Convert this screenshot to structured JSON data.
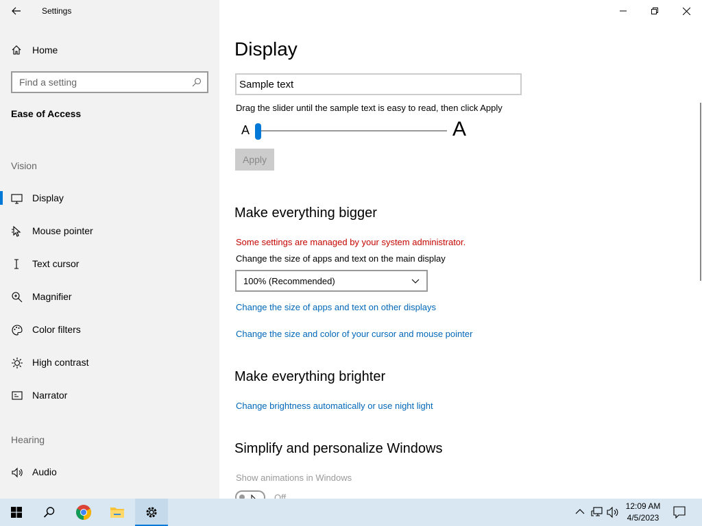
{
  "window": {
    "title": "Settings"
  },
  "sidebar": {
    "home_label": "Home",
    "search_placeholder": "Find a setting",
    "section_title": "Ease of Access",
    "groups": {
      "vision": "Vision",
      "hearing": "Hearing"
    },
    "items": [
      {
        "label": "Display",
        "icon": "display-icon",
        "selected": true
      },
      {
        "label": "Mouse pointer",
        "icon": "mouse-pointer-icon",
        "selected": false
      },
      {
        "label": "Text cursor",
        "icon": "text-cursor-icon",
        "selected": false
      },
      {
        "label": "Magnifier",
        "icon": "magnifier-icon",
        "selected": false
      },
      {
        "label": "Color filters",
        "icon": "color-filters-icon",
        "selected": false
      },
      {
        "label": "High contrast",
        "icon": "high-contrast-icon",
        "selected": false
      },
      {
        "label": "Narrator",
        "icon": "narrator-icon",
        "selected": false
      },
      {
        "label": "Audio",
        "icon": "audio-icon",
        "selected": false
      }
    ]
  },
  "main": {
    "page_title": "Display",
    "sample_text": "Sample text",
    "slider_instruction": "Drag the slider until the sample text is easy to read, then click Apply",
    "slider_small_label": "A",
    "slider_large_label": "A",
    "slider_value": 0,
    "apply_label": "Apply",
    "bigger": {
      "heading": "Make everything bigger",
      "admin_warning": "Some settings are managed by your system administrator.",
      "size_label": "Change the size of apps and text on the main display",
      "size_value": "100% (Recommended)",
      "link_other_displays": "Change the size of apps and text on other displays",
      "link_cursor": "Change the size and color of your cursor and mouse pointer"
    },
    "brighter": {
      "heading": "Make everything brighter",
      "link_brightness": "Change brightness automatically or use night light"
    },
    "simplify": {
      "heading": "Simplify and personalize Windows",
      "animations_label": "Show animations in Windows",
      "animations_state": "Off"
    }
  },
  "taskbar": {
    "time": "12:09 AM",
    "date": "4/5/2023"
  },
  "colors": {
    "accent": "#0078d7",
    "link": "#0067b8",
    "warning": "#c50500",
    "sidebar_bg": "#f2f2f2",
    "taskbar_bg": "#d8e7f2"
  }
}
